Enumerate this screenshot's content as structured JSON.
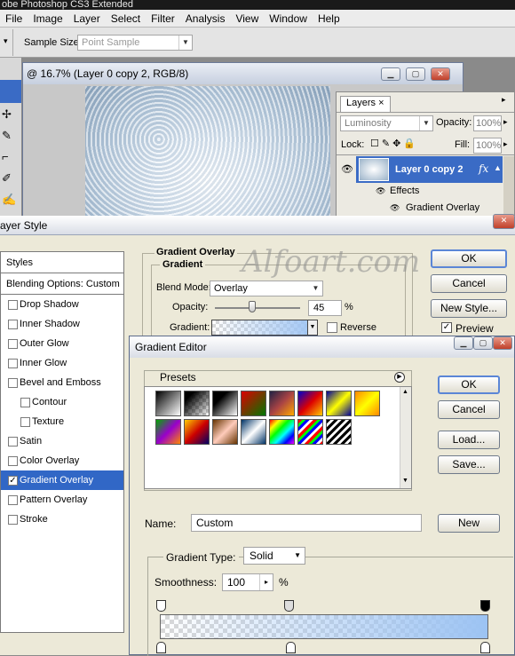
{
  "app": {
    "title": "obe Photoshop CS3 Extended"
  },
  "menu": [
    "File",
    "Image",
    "Layer",
    "Select",
    "Filter",
    "Analysis",
    "View",
    "Window",
    "Help"
  ],
  "options": {
    "sample_size_label": "Sample Size:",
    "sample_size_value": "Point Sample"
  },
  "document": {
    "title": "@ 16.7% (Layer 0 copy 2, RGB/8)"
  },
  "layers": {
    "tab": "Layers",
    "tab_close": "×",
    "blend_mode": "Luminosity",
    "opacity_label": "Opacity:",
    "opacity_value": "100%",
    "lock_label": "Lock:",
    "fill_label": "Fill:",
    "fill_value": "100%",
    "layer_name": "Layer 0 copy 2",
    "fx": "fx",
    "effects_label": "Effects",
    "effect_item": "Gradient Overlay"
  },
  "layer_style": {
    "title": "ayer Style",
    "styles_header": "Styles",
    "blending_options": "Blending Options: Custom",
    "items": [
      {
        "label": "Drop Shadow",
        "checked": false,
        "sub": false
      },
      {
        "label": "Inner Shadow",
        "checked": false,
        "sub": false
      },
      {
        "label": "Outer Glow",
        "checked": false,
        "sub": false
      },
      {
        "label": "Inner Glow",
        "checked": false,
        "sub": false
      },
      {
        "label": "Bevel and Emboss",
        "checked": false,
        "sub": false
      },
      {
        "label": "Contour",
        "checked": false,
        "sub": true
      },
      {
        "label": "Texture",
        "checked": false,
        "sub": true
      },
      {
        "label": "Satin",
        "checked": false,
        "sub": false
      },
      {
        "label": "Color Overlay",
        "checked": false,
        "sub": false
      },
      {
        "label": "Gradient Overlay",
        "checked": true,
        "sub": false
      },
      {
        "label": "Pattern Overlay",
        "checked": false,
        "sub": false
      },
      {
        "label": "Stroke",
        "checked": false,
        "sub": false
      }
    ],
    "section_title": "Gradient Overlay",
    "subsection": "Gradient",
    "blend_mode_label": "Blend Mode:",
    "blend_mode_value": "Overlay",
    "opacity_label": "Opacity:",
    "opacity_value": "45",
    "opacity_unit": "%",
    "gradient_label": "Gradient:",
    "reverse_label": "Reverse",
    "ok": "OK",
    "cancel": "Cancel",
    "new_style": "New Style...",
    "preview": "Preview"
  },
  "watermark": "Alfoart.com",
  "gradient_editor": {
    "title": "Gradient Editor",
    "presets_label": "Presets",
    "ok": "OK",
    "cancel": "Cancel",
    "load": "Load...",
    "save": "Save...",
    "name_label": "Name:",
    "name_value": "Custom",
    "new": "New",
    "gradient_type_label": "Gradient Type:",
    "gradient_type_value": "Solid",
    "smoothness_label": "Smoothness:",
    "smoothness_value": "100",
    "smoothness_unit": "%"
  },
  "colors": {
    "selection": "#3167c6",
    "layer_highlight": "#3a6bc5",
    "gradient_end": "#9cc3f3"
  }
}
